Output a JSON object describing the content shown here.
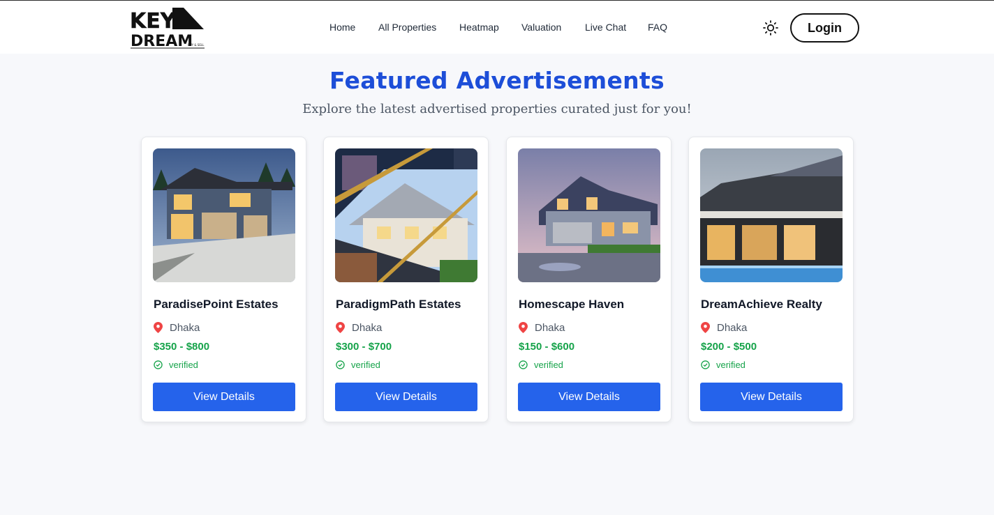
{
  "header": {
    "logo_text_top": "KEY",
    "logo_text_bottom": "DREAM",
    "logo_tagline": "BUY & SELL",
    "nav": [
      "Home",
      "All Properties",
      "Heatmap",
      "Valuation",
      "Live Chat",
      "FAQ"
    ],
    "theme_icon": "sun-icon",
    "login_label": "Login"
  },
  "section": {
    "title": "Featured Advertisements",
    "subtitle": "Explore the latest advertised properties curated just for you!"
  },
  "cards": [
    {
      "title": "ParadisePoint Estates",
      "location": "Dhaka",
      "price": "$350 - $800",
      "status": "verified",
      "button": "View Details"
    },
    {
      "title": "ParadigmPath Estates",
      "location": "Dhaka",
      "price": "$300 - $700",
      "status": "verified",
      "button": "View Details"
    },
    {
      "title": "Homescape Haven",
      "location": "Dhaka",
      "price": "$150 - $600",
      "status": "verified",
      "button": "View Details"
    },
    {
      "title": "DreamAchieve Realty",
      "location": "Dhaka",
      "price": "$200 - $500",
      "status": "verified",
      "button": "View Details"
    }
  ],
  "colors": {
    "accent": "#1d4ed8",
    "button": "#2563eb",
    "price": "#16a34a",
    "pin": "#ef4444",
    "page_bg": "#f7f8fb"
  }
}
